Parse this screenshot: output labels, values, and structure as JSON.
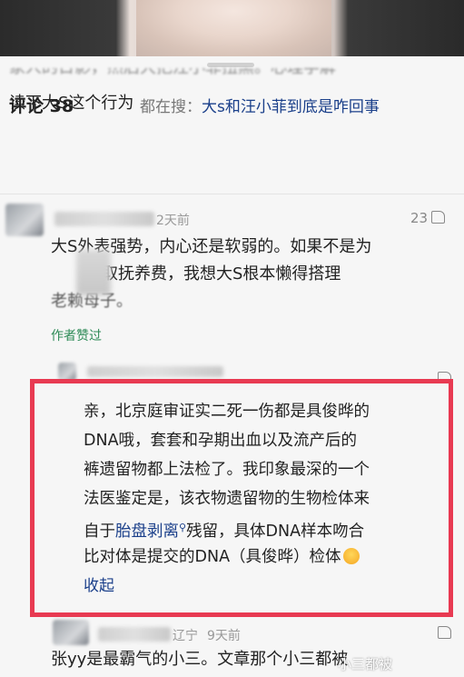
{
  "comments_header": {
    "title": "评论 38",
    "search_prefix": "都在搜：",
    "search_keyword": "大s和汪小菲到底是咋回事"
  },
  "comment1": {
    "faded_line": "家人的日影，然后大把汪小菲扭黑。心理学解",
    "last_line": "读下大S这个行为"
  },
  "comment2": {
    "time": "2天前",
    "likes": "23",
    "line1": "大S外表强势，内心还是软弱的。如果不是为",
    "line2": "争取抚养费，我想大S根本懒得搭理",
    "line3": "老赖母子。",
    "author_liked": "作者赞过"
  },
  "reply": {
    "line1": "亲，北京庭审证实二死一伤都是具俊晔的",
    "line2": "DNA哦，套套和孕期出血以及流产后的",
    "line3": "裤遗留物都上法检了。我印象最深的一个",
    "line4": "法医鉴定是，该衣物遗留物的生物检体来",
    "line5_pre": "自于",
    "line5_link": "胎盘剥离",
    "line5_post": "残留，具体DNA样本吻合",
    "line6": "比对体是提交的DNA（具俊晔）检体",
    "collapse": "收起"
  },
  "comment3": {
    "location": "辽宁",
    "time": "9天前",
    "text": "张yy是最霸气的小三。文章那个小三都被"
  },
  "watermark": "小三都被",
  "colors": {
    "highlight_border": "#e83a52",
    "link": "#1a3f8a",
    "author_liked": "#2e8b57"
  }
}
